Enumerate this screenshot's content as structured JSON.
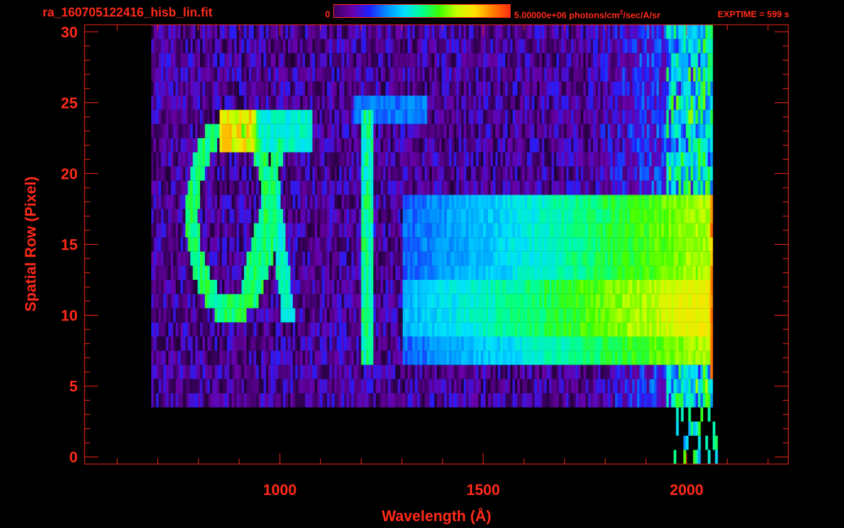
{
  "header": {
    "file_title": "ra_160705122416_hisb_lin.fit",
    "colorbar_min": "0",
    "colorbar_max_prefix": "5.00000e+06 photons/cm",
    "colorbar_max_sup": "2",
    "colorbar_max_suffix": "/sec/A/sr",
    "exptime": "EXPTIME = 599 s"
  },
  "colors": {
    "axis": "#ff2a1a",
    "background": "#000000",
    "colormap": [
      "#000000",
      "#3a0060",
      "#6a00a8",
      "#2020ff",
      "#0090ff",
      "#00e0ff",
      "#00ff90",
      "#40ff00",
      "#c8ff00",
      "#ffe000",
      "#ff8000",
      "#ff3010"
    ]
  },
  "chart_data": {
    "type": "heatmap",
    "xlabel": "Wavelength (Å)",
    "ylabel": "Spatial Row (Pixel)",
    "xlim": [
      520,
      2250
    ],
    "ylim": [
      -0.5,
      30.5
    ],
    "x_ticks": [
      1000,
      1500,
      2000
    ],
    "y_ticks": [
      0,
      5,
      10,
      15,
      20,
      25,
      30
    ],
    "colorbar": {
      "min": 0,
      "max": 5000000,
      "units": "photons/cm^2/sec/A/sr"
    },
    "grid": false,
    "emission_rows_range": [
      4,
      30
    ],
    "emission_wavelength_range": [
      685,
      2065
    ],
    "features": [
      {
        "name": "Lyman-alpha line",
        "wavelength": 1216,
        "rows": [
          7,
          24
        ],
        "intensity_fraction": 0.55
      },
      {
        "name": "continuum band",
        "wavelength_range": [
          1300,
          2065
        ],
        "rows": [
          7,
          18
        ],
        "intensity_fraction": 0.6
      },
      {
        "name": "loop arc",
        "wavelength_range": [
          790,
          1060
        ],
        "rows": [
          10,
          24
        ],
        "intensity_fraction": 0.55
      }
    ]
  }
}
